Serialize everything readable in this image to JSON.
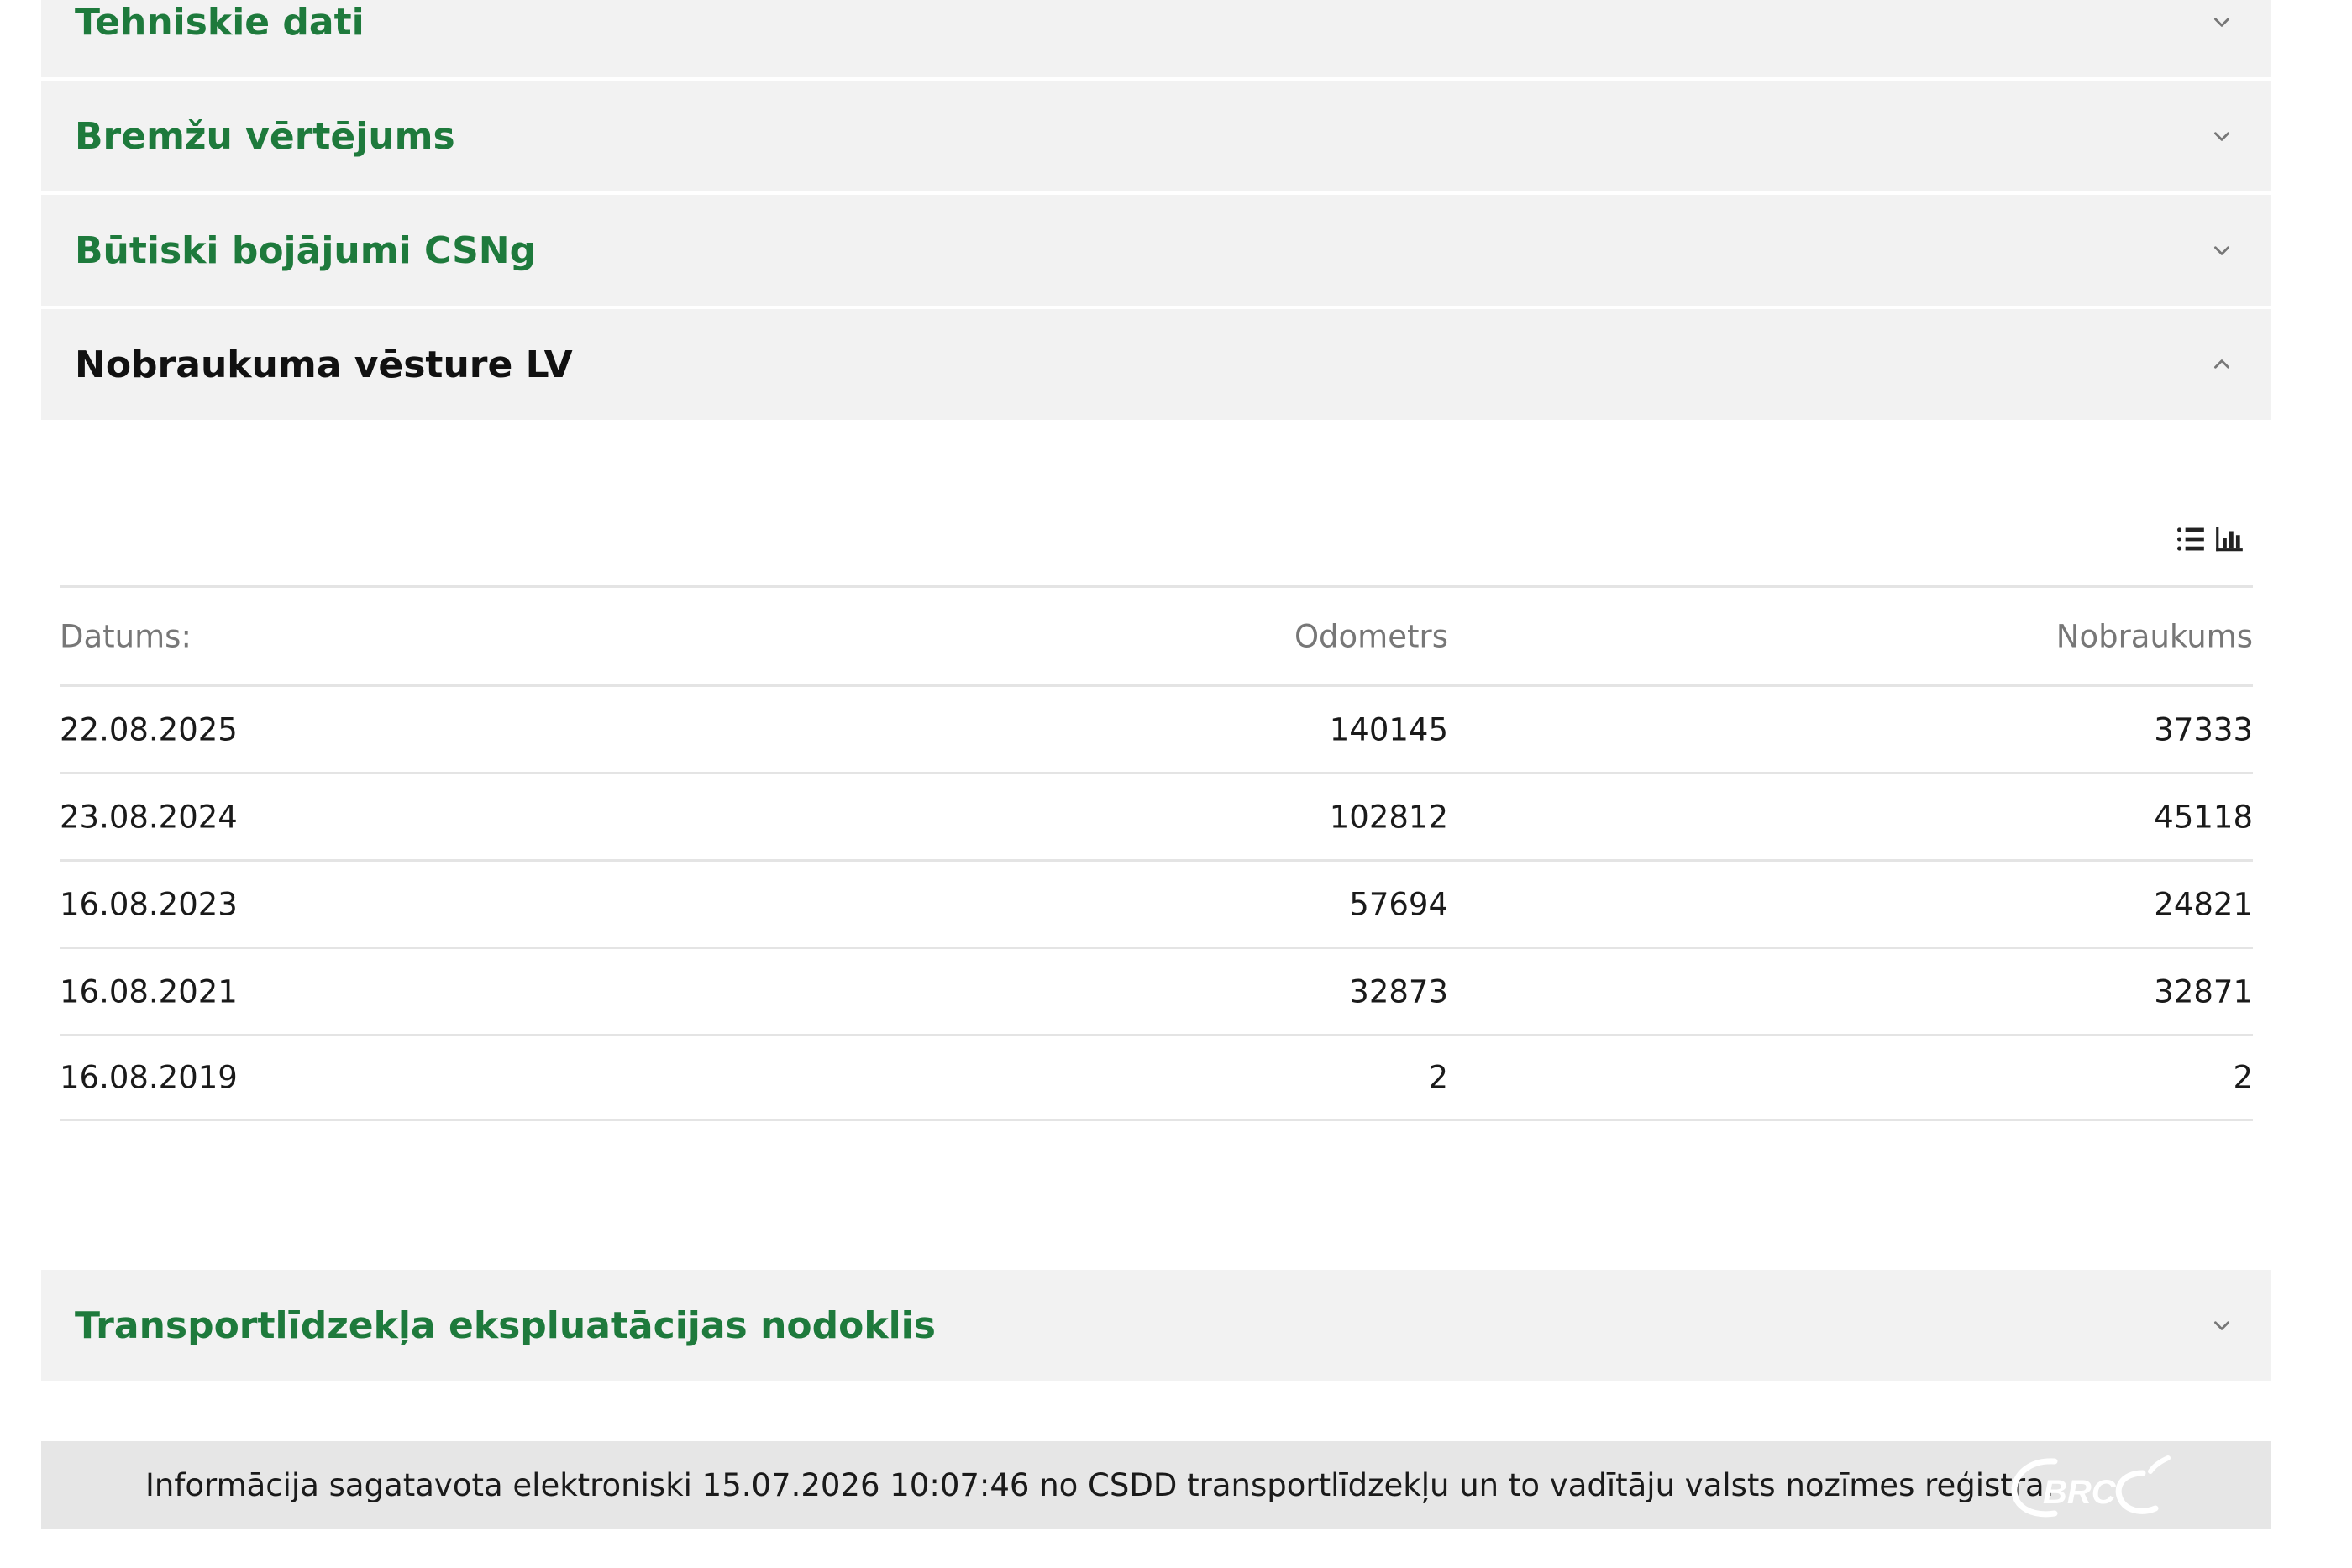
{
  "sections": {
    "tehniskie_dati": "Tehniskie dati",
    "bremzu_vertejums": "Bremžu vērtējums",
    "butiski_bojajumi": "Būtiski bojājumi CSNg",
    "nobraukuma_vesture": "Nobraukuma vēsture LV",
    "nodoklis": "Transportlīdzekļa ekspluatācijas nodoklis"
  },
  "mileage_table": {
    "headers": {
      "date": "Datums:",
      "odometer": "Odometrs",
      "mileage": "Nobraukums"
    },
    "rows": [
      {
        "date": "22.08.2025",
        "odometer": "140145",
        "mileage": "37333"
      },
      {
        "date": "23.08.2024",
        "odometer": "102812",
        "mileage": "45118"
      },
      {
        "date": "16.08.2023",
        "odometer": "57694",
        "mileage": "24821"
      },
      {
        "date": "16.08.2021",
        "odometer": "32873",
        "mileage": "32871"
      },
      {
        "date": "16.08.2019",
        "odometer": "2",
        "mileage": "2"
      }
    ]
  },
  "icons": {
    "list_view": "list-icon",
    "chart_view": "bar-chart-icon",
    "expand": "chevron-down-icon",
    "collapse": "chevron-up-icon"
  },
  "footer": {
    "text": "Informācija sagatavota elektroniski 15.07.2026 10:07:46 no CSDD transportlīdzekļu un to vadītāju valsts nozīmes reģistra.",
    "logo_text": "BRC"
  },
  "colors": {
    "accent_green": "#1e7a3c",
    "header_bg": "#f2f2f2",
    "footer_bg": "#e6e6e6"
  }
}
